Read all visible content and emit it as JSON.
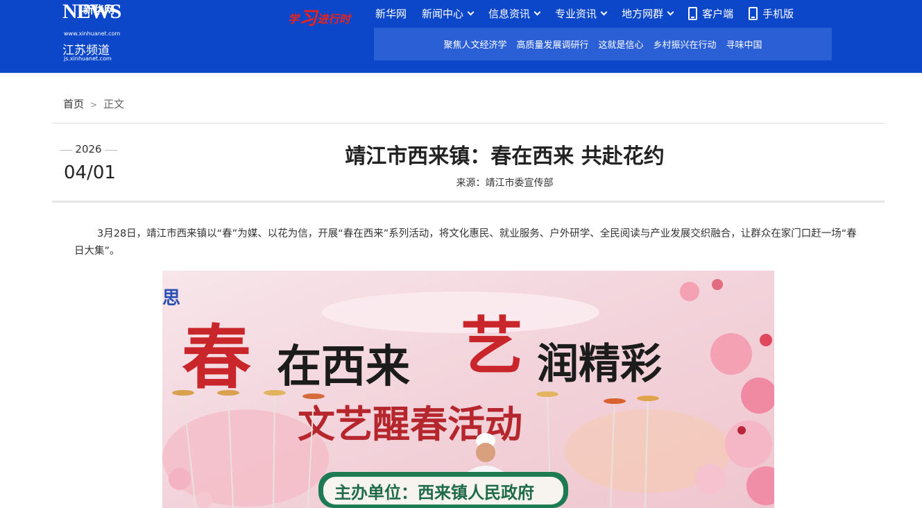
{
  "header": {
    "logo": {
      "news": "NEWS",
      "cn_name": "新华网",
      "url": "www.xinhuanet.com",
      "channel": "江苏频道",
      "channel_url": "js.xinhuanet.com"
    },
    "slogan": {
      "xue": "学",
      "xi": "习",
      "rest": "进行时"
    },
    "nav": [
      {
        "label": "新华网"
      },
      {
        "label": "新闻中心"
      },
      {
        "label": "信息资讯"
      },
      {
        "label": "专业资讯"
      },
      {
        "label": "地方网群"
      },
      {
        "label": "客户端"
      },
      {
        "label": "手机版"
      }
    ],
    "subnav": [
      "聚焦人文经济学",
      "高质量发展调研行",
      "这就是信心",
      "乡村振兴在行动",
      "寻味中国"
    ]
  },
  "breadcrumb": {
    "home": "首页",
    "sep": ">",
    "current": "正文"
  },
  "article": {
    "year": "2026",
    "monthday": "04/01",
    "title": "靖江市西来镇：春在西来 共赴花约",
    "source": "来源：靖江市委宣传部",
    "paragraph": "3月28日，靖江市西来镇以“春”为媒、以花为信，开展“春在西来”系列活动，将文化惠民、就业服务、户外研学、全民阅读与产业发展交织融合，让群众在家门口赶一场“春日大集”。"
  },
  "photo": {
    "banner_char1": "春",
    "banner_text1": "在西来",
    "banner_char2": "艺",
    "banner_text2": "润精彩",
    "banner_sub": "文艺醒春活动",
    "banner_org": "主办单位：西来镇人民政府",
    "corner_char": "思",
    "accent_red": "#c8262a",
    "accent_green": "#1d7a52"
  },
  "colors": {
    "header_bg": "#0c47c9",
    "subnav_bg": "#2b5fd6",
    "slogan_red": "#e8231c"
  }
}
